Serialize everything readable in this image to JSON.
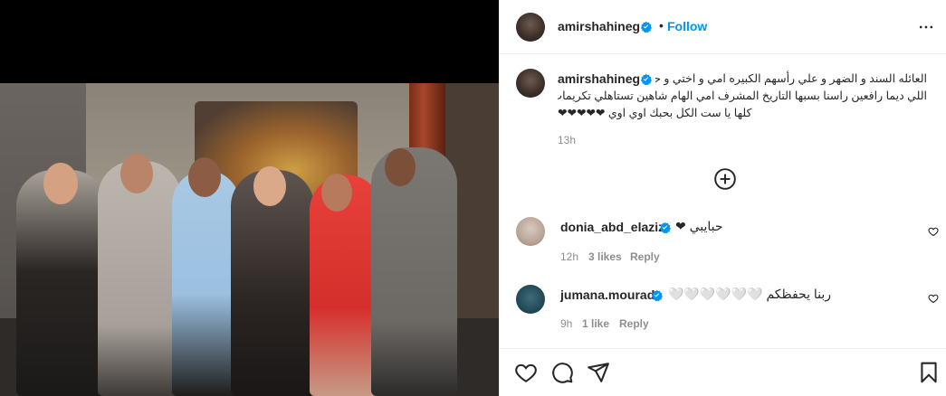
{
  "post": {
    "owner_username": "amirshahineg",
    "follow_label": "Follow",
    "separator": "•",
    "caption_lines": [
      "العائله السند و الضهر و علي رأسهم الكبيره امي و اختي و حبيبتي",
      "اللي ديما رافعين راسنا بسبها التاريخ المشرف امي الهام شاهين تستاهلي تكريمات الدنيا",
      "كلها يا ست الكل بحبك اوي اوي ❤❤❤❤❤"
    ],
    "caption_time": "13h"
  },
  "comments": [
    {
      "username": "donia_abd_elaziz",
      "text": "حبايبي ❤",
      "time": "12h",
      "likes": "3 likes",
      "reply_label": "Reply"
    },
    {
      "username": "jumana.mourad",
      "text": "ربنا يحفظكم 🤍🤍🤍🤍🤍🤍",
      "time": "9h",
      "likes": "1 like",
      "reply_label": "Reply"
    }
  ],
  "colors": {
    "link_blue": "#0095f6",
    "verified_blue": "#0095f6",
    "text_primary": "#262626",
    "text_secondary": "#8e8e8e",
    "divider": "#efefef"
  },
  "icons": {
    "more": "more-options-icon",
    "verified": "verified-badge-icon",
    "add_comment": "plus-circle-icon",
    "like": "heart-icon",
    "comment": "comment-bubble-icon",
    "share": "paper-plane-icon",
    "save": "bookmark-icon"
  }
}
